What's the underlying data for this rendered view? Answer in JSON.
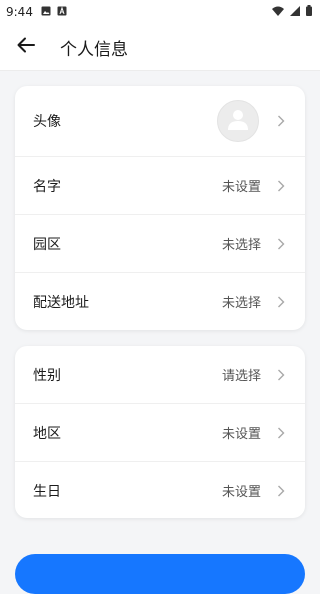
{
  "status": {
    "time": "9:44",
    "icons": [
      "gallery-icon",
      "text-icon",
      "wifi-icon",
      "signal-icon",
      "battery-icon"
    ]
  },
  "header": {
    "title": "个人信息",
    "back_icon": "arrow-left-icon"
  },
  "profile_card": {
    "avatar_label": "头像",
    "name_label": "名字",
    "name_value": "未设置",
    "park_label": "园区",
    "park_value": "未选择",
    "address_label": "配送地址",
    "address_value": "未选择"
  },
  "details_card": {
    "gender_label": "性别",
    "gender_value": "请选择",
    "region_label": "地区",
    "region_value": "未设置",
    "birthday_label": "生日",
    "birthday_value": "未设置"
  },
  "colors": {
    "primary": "#1677ff",
    "background": "#f4f5f7"
  }
}
